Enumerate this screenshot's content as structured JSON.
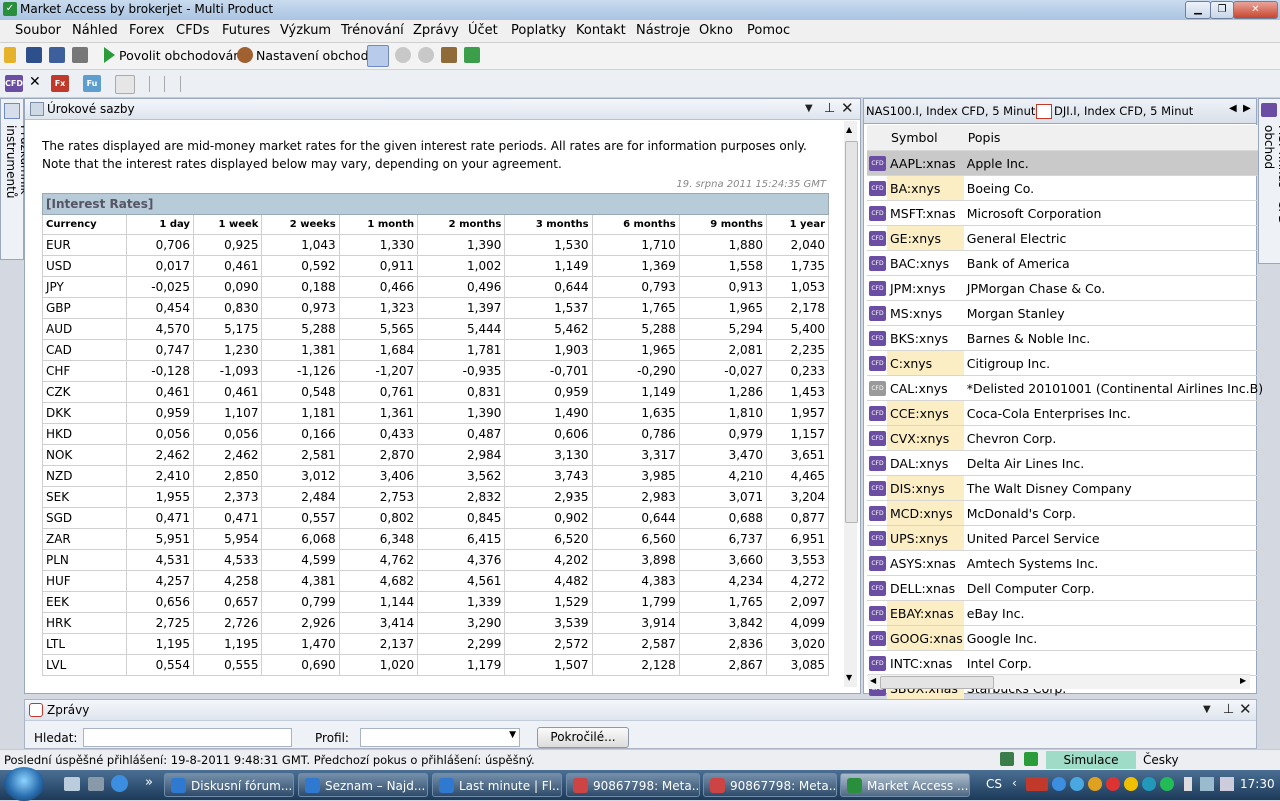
{
  "window": {
    "title": "Market Access by brokerjet - Multi Product"
  },
  "menu": [
    "Soubor",
    "Náhled",
    "Forex",
    "CFDs",
    "Futures",
    "Výzkum",
    "Trénování",
    "Zprávy",
    "Účet",
    "Poplatky",
    "Kontakt",
    "Nástroje",
    "Okno",
    "Pomoc"
  ],
  "toolbar": {
    "enable_trading": "Povolit obchodování",
    "trade_settings": "Nastavení obchodů"
  },
  "doc_tabs": [
    "CFD",
    "Fx",
    "Fu"
  ],
  "left_sidebar": {
    "label": "Průzkumník instrumentů"
  },
  "right_sidebar": {
    "label": "MSFT:xnas - CFD obchod"
  },
  "rates_panel": {
    "title": "Úrokové sazby",
    "intro": "The rates displayed are mid-money market rates for the given interest rate periods. All rates are for information purposes only. Note that the interest rates displayed below may vary, depending on your agreement.",
    "timestamp": "19. srpna 2011 15:24:35 GMT",
    "caption": "[Interest Rates]",
    "columns": [
      "Currency",
      "1 day",
      "1 week",
      "2 weeks",
      "1 month",
      "2 months",
      "3 months",
      "6 months",
      "9 months",
      "1 year"
    ],
    "rows": [
      [
        "EUR",
        "0,706",
        "0,925",
        "1,043",
        "1,330",
        "1,390",
        "1,530",
        "1,710",
        "1,880",
        "2,040"
      ],
      [
        "USD",
        "0,017",
        "0,461",
        "0,592",
        "0,911",
        "1,002",
        "1,149",
        "1,369",
        "1,558",
        "1,735"
      ],
      [
        "JPY",
        "-0,025",
        "0,090",
        "0,188",
        "0,466",
        "0,496",
        "0,644",
        "0,793",
        "0,913",
        "1,053"
      ],
      [
        "GBP",
        "0,454",
        "0,830",
        "0,973",
        "1,323",
        "1,397",
        "1,537",
        "1,765",
        "1,965",
        "2,178"
      ],
      [
        "AUD",
        "4,570",
        "5,175",
        "5,288",
        "5,565",
        "5,444",
        "5,462",
        "5,288",
        "5,294",
        "5,400"
      ],
      [
        "CAD",
        "0,747",
        "1,230",
        "1,381",
        "1,684",
        "1,781",
        "1,903",
        "1,965",
        "2,081",
        "2,235"
      ],
      [
        "CHF",
        "-0,128",
        "-1,093",
        "-1,126",
        "-1,207",
        "-0,935",
        "-0,701",
        "-0,290",
        "-0,027",
        "0,233"
      ],
      [
        "CZK",
        "0,461",
        "0,461",
        "0,548",
        "0,761",
        "0,831",
        "0,959",
        "1,149",
        "1,286",
        "1,453"
      ],
      [
        "DKK",
        "0,959",
        "1,107",
        "1,181",
        "1,361",
        "1,390",
        "1,490",
        "1,635",
        "1,810",
        "1,957"
      ],
      [
        "HKD",
        "0,056",
        "0,056",
        "0,166",
        "0,433",
        "0,487",
        "0,606",
        "0,786",
        "0,979",
        "1,157"
      ],
      [
        "NOK",
        "2,462",
        "2,462",
        "2,581",
        "2,870",
        "2,984",
        "3,130",
        "3,317",
        "3,470",
        "3,651"
      ],
      [
        "NZD",
        "2,410",
        "2,850",
        "3,012",
        "3,406",
        "3,562",
        "3,743",
        "3,985",
        "4,210",
        "4,465"
      ],
      [
        "SEK",
        "1,955",
        "2,373",
        "2,484",
        "2,753",
        "2,832",
        "2,935",
        "2,983",
        "3,071",
        "3,204"
      ],
      [
        "SGD",
        "0,471",
        "0,471",
        "0,557",
        "0,802",
        "0,845",
        "0,902",
        "0,644",
        "0,688",
        "0,877"
      ],
      [
        "ZAR",
        "5,951",
        "5,954",
        "6,068",
        "6,348",
        "6,415",
        "6,520",
        "6,560",
        "6,737",
        "6,951"
      ],
      [
        "PLN",
        "4,531",
        "4,533",
        "4,599",
        "4,762",
        "4,376",
        "4,202",
        "3,898",
        "3,660",
        "3,553"
      ],
      [
        "HUF",
        "4,257",
        "4,258",
        "4,381",
        "4,682",
        "4,561",
        "4,482",
        "4,383",
        "4,234",
        "4,272"
      ],
      [
        "EEK",
        "0,656",
        "0,657",
        "0,799",
        "1,144",
        "1,339",
        "1,529",
        "1,799",
        "1,765",
        "2,097"
      ],
      [
        "HRK",
        "2,725",
        "2,726",
        "2,926",
        "3,414",
        "3,290",
        "3,539",
        "3,914",
        "3,842",
        "4,099"
      ],
      [
        "LTL",
        "1,195",
        "1,195",
        "1,470",
        "2,137",
        "2,299",
        "2,572",
        "2,587",
        "2,836",
        "3,020"
      ],
      [
        "LVL",
        "0,554",
        "0,555",
        "0,690",
        "1,020",
        "1,179",
        "1,507",
        "2,128",
        "2,867",
        "3,085"
      ]
    ]
  },
  "symbols_panel": {
    "tabs": [
      "NAS100.I, Index CFD, 5 Minut",
      "DJI.I, Index CFD, 5 Minut"
    ],
    "columns": [
      "Symbol",
      "Popis"
    ],
    "rows": [
      {
        "symbol": "AAPL:xnas",
        "desc": "Apple Inc.",
        "hl": true,
        "sel": true
      },
      {
        "symbol": "BA:xnys",
        "desc": "Boeing Co.",
        "hl": true
      },
      {
        "symbol": "MSFT:xnas",
        "desc": "Microsoft Corporation",
        "hl": false
      },
      {
        "symbol": "GE:xnys",
        "desc": "General Electric",
        "hl": true
      },
      {
        "symbol": "BAC:xnys",
        "desc": "Bank of America",
        "hl": false
      },
      {
        "symbol": "JPM:xnys",
        "desc": "JPMorgan Chase & Co.",
        "hl": false
      },
      {
        "symbol": "MS:xnys",
        "desc": "Morgan Stanley",
        "hl": false
      },
      {
        "symbol": "BKS:xnys",
        "desc": "Barnes & Noble Inc.",
        "hl": false
      },
      {
        "symbol": "C:xnys",
        "desc": "Citigroup Inc.",
        "hl": true
      },
      {
        "symbol": "CAL:xnys",
        "desc": "*Delisted 20101001 (Continental Airlines Inc.B)",
        "hl": false,
        "grey": true
      },
      {
        "symbol": "CCE:xnys",
        "desc": "Coca-Cola Enterprises Inc.",
        "hl": true
      },
      {
        "symbol": "CVX:xnys",
        "desc": "Chevron Corp.",
        "hl": true
      },
      {
        "symbol": "DAL:xnys",
        "desc": "Delta Air Lines Inc.",
        "hl": false
      },
      {
        "symbol": "DIS:xnys",
        "desc": "The Walt Disney Company",
        "hl": true
      },
      {
        "symbol": "MCD:xnys",
        "desc": "McDonald's Corp.",
        "hl": true
      },
      {
        "symbol": "UPS:xnys",
        "desc": "United Parcel Service",
        "hl": true
      },
      {
        "symbol": "ASYS:xnas",
        "desc": "Amtech Systems Inc.",
        "hl": false
      },
      {
        "symbol": "DELL:xnas",
        "desc": "Dell Computer Corp.",
        "hl": false
      },
      {
        "symbol": "EBAY:xnas",
        "desc": "eBay Inc.",
        "hl": true
      },
      {
        "symbol": "GOOG:xnas",
        "desc": "Google Inc.",
        "hl": true
      },
      {
        "symbol": "INTC:xnas",
        "desc": "Intel Corp.",
        "hl": false
      },
      {
        "symbol": "SBUX:xnas",
        "desc": "Starbucks Corp.",
        "hl": true
      }
    ]
  },
  "messages": {
    "title": "Zprávy",
    "search_label": "Hledat:",
    "profile_label": "Profil:",
    "advanced": "Pokročilé..."
  },
  "status": {
    "text": "Poslední úspěšné přihlášení: 19-8-2011 9:48:31 GMT. Předchozí pokus o přihlášení: úspěšný.",
    "mode": "Simulace",
    "language": "Česky"
  },
  "taskbar": {
    "tasks": [
      "Diskusní fórum...",
      "Seznam – Najd...",
      "Last minute | Fl...",
      "90867798: Meta...",
      "90867798: Meta...",
      "Market Access ..."
    ],
    "lang": "CS",
    "clock": "17:30"
  }
}
